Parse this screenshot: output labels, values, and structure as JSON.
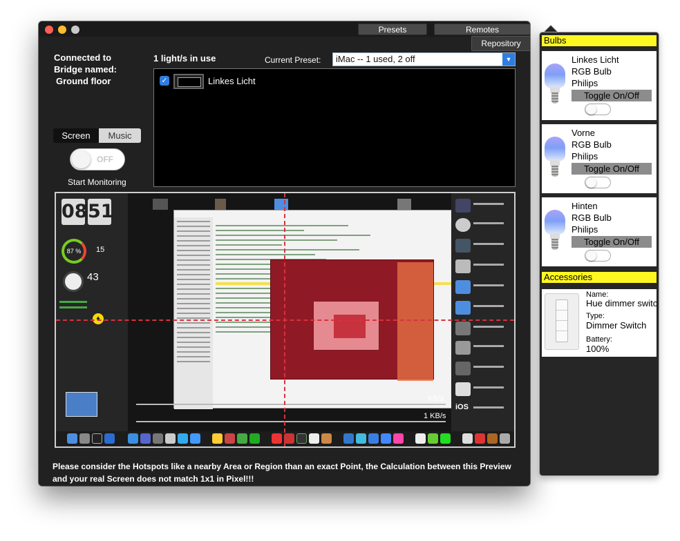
{
  "window": {
    "presets_tab": "Presets",
    "remotes_tab": "Remotes",
    "repository_button": "Repository"
  },
  "connection": {
    "line1": "Connected to",
    "line2": "Bridge named:",
    "line3": "Ground floor"
  },
  "lights_in_use": "1 light/s in use",
  "current_preset": {
    "label": "Current Preset:",
    "value": "iMac -- 1 used, 2 off"
  },
  "light_list": [
    {
      "name": "Linkes Licht",
      "checked": true
    }
  ],
  "mode": {
    "screen_label": "Screen",
    "music_label": "Music",
    "selected": "Screen"
  },
  "monitoring": {
    "state_label": "OFF",
    "start_label": "Start Monitoring"
  },
  "preview": {
    "clock_hour": "08",
    "clock_min": "51",
    "ring_percent": "87 %",
    "ring_side": "15",
    "temperature": "43",
    "net_up": "KB/s",
    "net_down": "1 KB/s",
    "ios_label": "iOS"
  },
  "notice": "Please consider the Hotspots like a nearby Area or Region than an exact Point, the Calculation between this Preview and your real Screen does not match 1x1 in Pixel!!!",
  "bulbs_section": {
    "header": "Bulbs",
    "items": [
      {
        "name": "Linkes Licht",
        "type": "RGB Bulb",
        "maker": "Philips",
        "toggle": "Toggle On/Off"
      },
      {
        "name": "Vorne",
        "type": "RGB Bulb",
        "maker": "Philips",
        "toggle": "Toggle On/Off"
      },
      {
        "name": "Hinten",
        "type": "RGB Bulb",
        "maker": "Philips",
        "toggle": "Toggle On/Off"
      }
    ]
  },
  "accessories_section": {
    "header": "Accessories",
    "item": {
      "name_label": "Name:",
      "name": "Hue dimmer switch",
      "type_label": "Type:",
      "type": "Dimmer Switch",
      "battery_label": "Battery:",
      "battery": "100%"
    }
  },
  "colors": {
    "window_bg": "#212121",
    "accent_blue": "#2f7de0",
    "section_header": "#fff722",
    "hotspot_line": "#d8323e"
  }
}
